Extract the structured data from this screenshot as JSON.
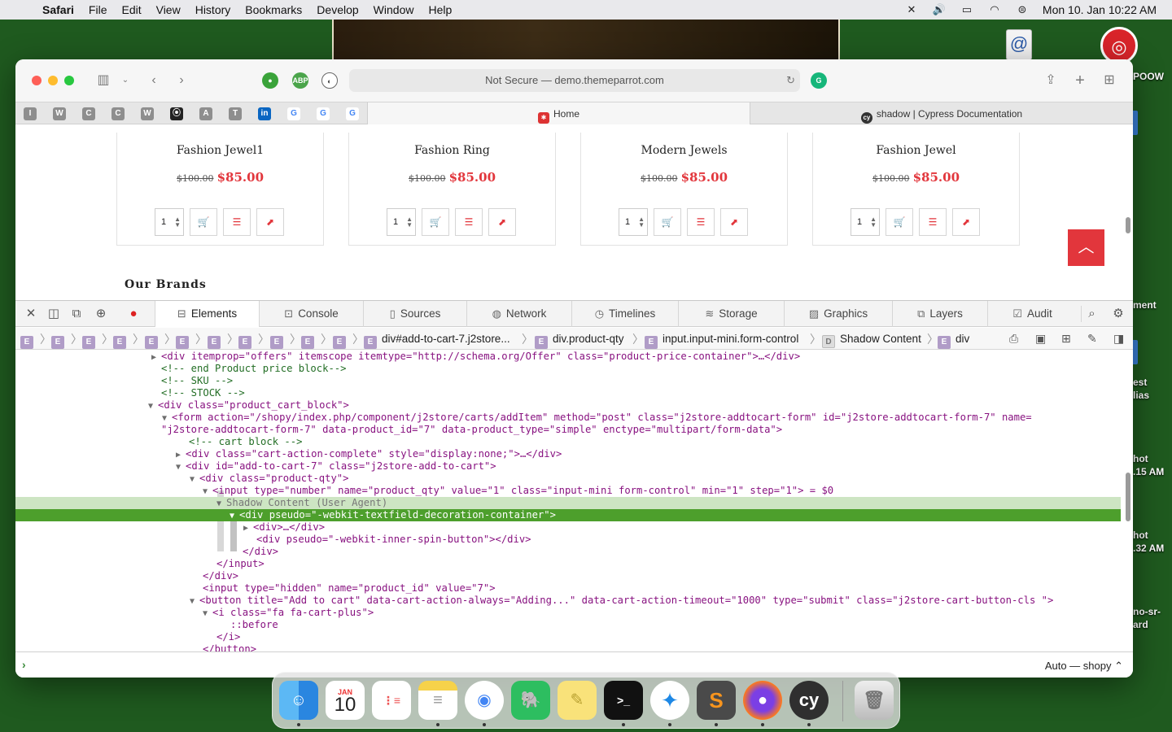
{
  "menubar": {
    "app": "Safari",
    "items": [
      "File",
      "Edit",
      "View",
      "History",
      "Bookmarks",
      "Develop",
      "Window",
      "Help"
    ],
    "clock": "Mon 10. Jan  10:22 AM"
  },
  "desktop": {
    "labels": [
      "POOW",
      "ment",
      "est",
      "lias",
      "hot",
      ".15 AM",
      "hot",
      ".32 AM",
      "no-sr-",
      "ard"
    ]
  },
  "safari": {
    "address": "Not Secure — demo.themeparrot.com",
    "favorites": [
      "I",
      "W",
      "C",
      "C",
      "W",
      "⦿",
      "A",
      "T",
      "in",
      "G",
      "G",
      "G"
    ],
    "tabs": [
      {
        "title": "Home",
        "active": true
      },
      {
        "title": "shadow | Cypress Documentation",
        "active": false
      }
    ]
  },
  "page": {
    "products": [
      {
        "name": "Fashion Jewel1",
        "old_price": "$100.00",
        "price": "$85.00",
        "qty": "1"
      },
      {
        "name": "Fashion Ring",
        "old_price": "$100.00",
        "price": "$85.00",
        "qty": "1"
      },
      {
        "name": "Modern Jewels",
        "old_price": "$100.00",
        "price": "$85.00",
        "qty": "1"
      },
      {
        "name": "Fashion Jewel",
        "old_price": "$100.00",
        "price": "$85.00",
        "qty": "1"
      }
    ],
    "brands_title": "Our Brands"
  },
  "inspector": {
    "tabs": [
      "Elements",
      "Console",
      "Sources",
      "Network",
      "Timelines",
      "Storage",
      "Graphics",
      "Layers",
      "Audit"
    ],
    "active_tab": "Elements",
    "breadcrumbs": {
      "e_badge": "E",
      "d_badge": "D",
      "items": [
        "div#add-to-cart-7.j2store...",
        "div.product-qty",
        "input.input-mini.form-control",
        "Shadow Content",
        "div"
      ]
    },
    "dom_lines": [
      "<div itemprop=\"offers\" itemscope itemtype=\"http://schema.org/Offer\" class=\"product-price-container\">…</div>",
      "<!-- end Product price block-->",
      "<!-- SKU -->",
      "<!-- STOCK -->",
      "<div class=\"product_cart_block\">",
      "<form action=\"/shopy/index.php/component/j2store/carts/addItem\" method=\"post\" class=\"j2store-addtocart-form\" id=\"j2store-addtocart-form-7\" name=",
      "\"j2store-addtocart-form-7\" data-product_id=\"7\" data-product_type=\"simple\" enctype=\"multipart/form-data\">",
      "<!-- cart block -->",
      "<div class=\"cart-action-complete\" style=\"display:none;\">…</div>",
      "<div id=\"add-to-cart-7\" class=\"j2store-add-to-cart\">",
      "<div class=\"product-qty\">",
      "<input type=\"number\" name=\"product_qty\" value=\"1\" class=\"input-mini form-control\" min=\"1\" step=\"1\"> = $0",
      "Shadow Content (User Agent)",
      "<div pseudo=\"-webkit-textfield-decoration-container\">",
      "<div>…</div>",
      "<div pseudo=\"-webkit-inner-spin-button\"></div>",
      "</div>",
      "</input>",
      "</div>",
      "<input type=\"hidden\" name=\"product_id\" value=\"7\">",
      "<button title=\"Add to cart\" data-cart-action-always=\"Adding...\" data-cart-action-timeout=\"1000\" type=\"submit\" class=\"j2store-cart-button-cls \">",
      "<i class=\"fa fa-cart-plus\">",
      "::before",
      "</i>",
      "</button>"
    ],
    "console_prompt": "›",
    "context": "Auto — shopy ⌃"
  },
  "dock": {
    "apps": [
      "Finder",
      "Calendar",
      "Reminders",
      "Notes",
      "Chrome",
      "Evernote",
      "Stickies",
      "Terminal",
      "Safari",
      "Sublime Text",
      "Firefox",
      "Cypress",
      "Trash"
    ],
    "calendar_month": "JAN",
    "calendar_day": "10",
    "cypress_label": "cy",
    "sublime_label": "S"
  },
  "icons": {
    "apple": "apple-icon",
    "sidebar": "sidebar-icon",
    "share": "share-icon",
    "new_tab": "plus-icon",
    "tab_overview": "grid-icon",
    "inspect": "crosshair-icon",
    "error": "error-icon",
    "search": "search-icon",
    "settings": "gear-icon"
  },
  "colors": {
    "accent_red": "#e2363c",
    "selection_green": "#4d9f2c",
    "shadow_row": "#cde5c3",
    "tag": "#881280",
    "attr_name": "#994500",
    "attr_value": "#1a1aa6",
    "comment": "#236e25"
  }
}
